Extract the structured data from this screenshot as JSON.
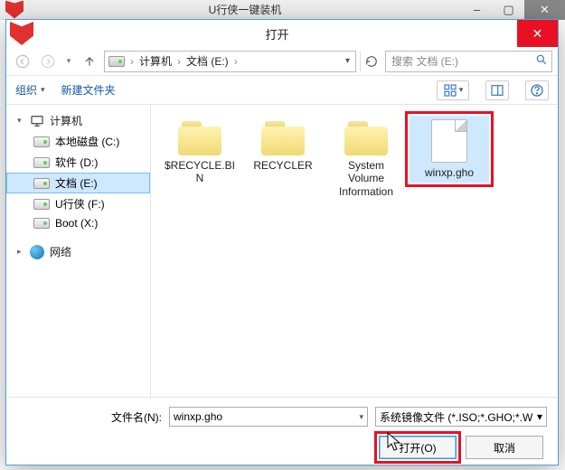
{
  "parent_window": {
    "title": "U行侠一键装机"
  },
  "dialog": {
    "title": "打开",
    "nav": {
      "breadcrumb": [
        "计算机",
        "文档 (E:)"
      ]
    },
    "search": {
      "placeholder": "搜索 文档 (E:)"
    },
    "toolbar": {
      "organize": "组织",
      "new_folder": "新建文件夹"
    },
    "tree": {
      "computer": "计算机",
      "drives": [
        {
          "label": "本地磁盘 (C:)"
        },
        {
          "label": "软件 (D:)"
        },
        {
          "label": "文档 (E:)",
          "selected": true
        },
        {
          "label": "U行侠 (F:)"
        },
        {
          "label": "Boot (X:)"
        }
      ],
      "network": "网络"
    },
    "items": [
      {
        "type": "folder",
        "name": "$RECYCLE.BIN"
      },
      {
        "type": "folder",
        "name": "RECYCLER"
      },
      {
        "type": "folder",
        "name": "System Volume Information"
      },
      {
        "type": "file",
        "name": "winxp.gho",
        "selected": true,
        "highlighted": true
      }
    ],
    "filename_label": "文件名(N):",
    "filename_value": "winxp.gho",
    "filter_label": "系统镜像文件 (*.ISO;*.GHO;*.W",
    "open_btn": "打开(O)",
    "cancel_btn": "取消"
  }
}
